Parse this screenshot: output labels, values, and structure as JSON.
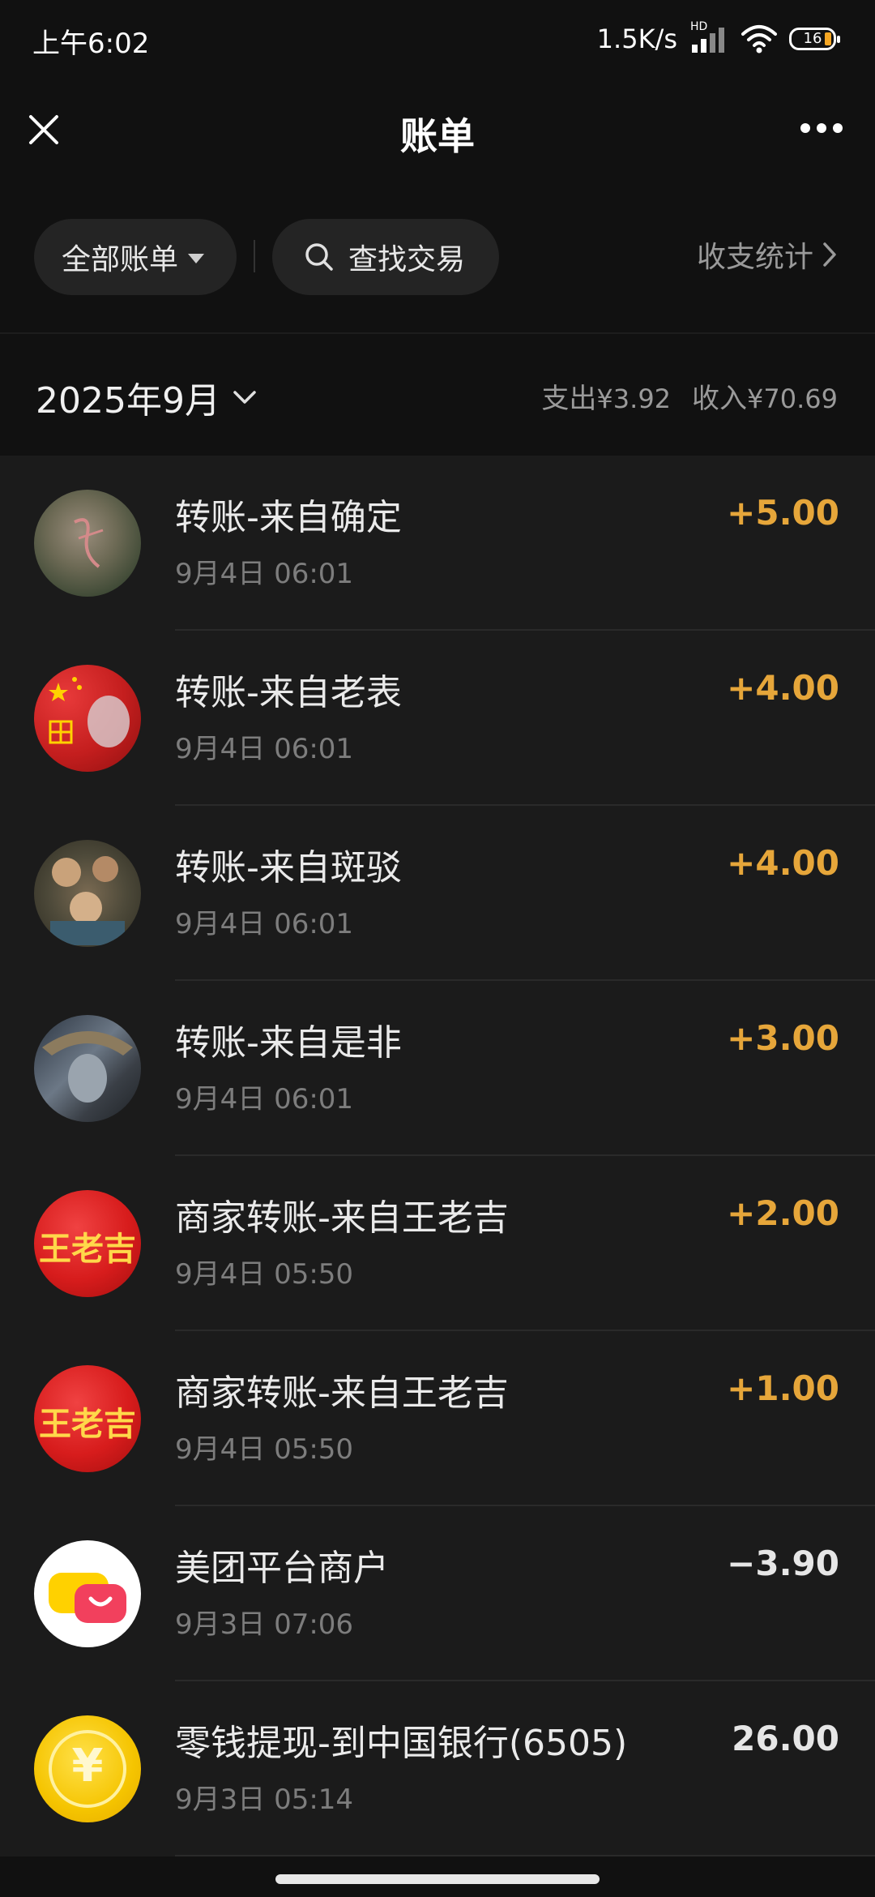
{
  "status_bar": {
    "time": "上午6:02",
    "net_speed": "1.5K/s",
    "signal_tag": "HD",
    "battery": "16"
  },
  "nav": {
    "title": "账单",
    "close_icon": "close-icon",
    "more_icon": "more-icon"
  },
  "filters": {
    "all_bills": "全部账单",
    "search": "查找交易",
    "stats": "收支统计"
  },
  "month": {
    "label": "2025年9月",
    "expense_label": "支出",
    "expense_value": "¥3.92",
    "income_label": "收入",
    "income_value": "¥70.69"
  },
  "transactions": [
    {
      "title": "转账-来自确定",
      "time": "9月4日 06:01",
      "amount": "+5.00",
      "type": "income"
    },
    {
      "title": "转账-来自老表",
      "time": "9月4日 06:01",
      "amount": "+4.00",
      "type": "income"
    },
    {
      "title": "转账-来自斑驳",
      "time": "9月4日 06:01",
      "amount": "+4.00",
      "type": "income"
    },
    {
      "title": "转账-来自是非",
      "time": "9月4日 06:01",
      "amount": "+3.00",
      "type": "income"
    },
    {
      "title": "商家转账-来自王老吉",
      "time": "9月4日 05:50",
      "amount": "+2.00",
      "type": "income",
      "avatar_text": "王老吉"
    },
    {
      "title": "商家转账-来自王老吉",
      "time": "9月4日 05:50",
      "amount": "+1.00",
      "type": "income",
      "avatar_text": "王老吉"
    },
    {
      "title": "美团平台商户",
      "time": "9月3日 07:06",
      "amount": "−3.90",
      "type": "expense"
    },
    {
      "title": "零钱提现-到中国银行(6505)",
      "time": "9月3日 05:14",
      "amount": "26.00",
      "type": "neutral",
      "avatar_text": "¥"
    }
  ],
  "colors": {
    "income": "#e6a63a",
    "background": "#111111",
    "list_background": "#1b1b1b"
  }
}
